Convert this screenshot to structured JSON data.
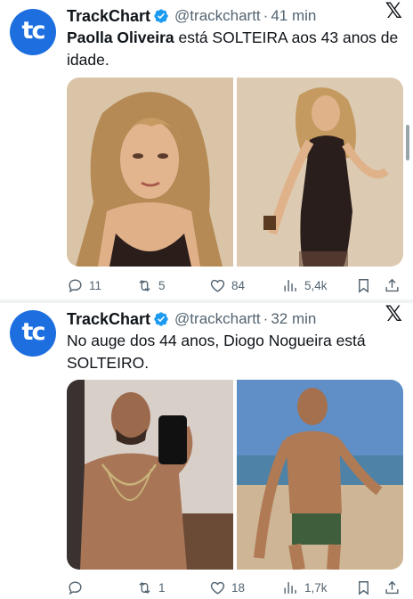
{
  "colors": {
    "accent": "#1d9bf0",
    "avatar_bg": "#1d6fe0",
    "text": "#0f1419",
    "muted": "#536471"
  },
  "tweets": [
    {
      "author": {
        "name": "TrackChart",
        "handle": "@trackchartt",
        "avatar_text": "tc",
        "verified": true
      },
      "separator": "·",
      "time": "41 min",
      "text_bold": "Paolla Oliveira",
      "text_rest": " está SOLTEIRA aos 43 anos de idade.",
      "media": [
        "photo-woman-portrait",
        "photo-woman-black-dress"
      ],
      "stats": {
        "replies": "11",
        "retweets": "5",
        "likes": "84",
        "views": "5,4k"
      }
    },
    {
      "author": {
        "name": "TrackChart",
        "handle": "@trackchartt",
        "avatar_text": "tc",
        "verified": true
      },
      "separator": "·",
      "time": "32 min",
      "text_bold": "",
      "text_rest": "No auge dos 44 anos, Diogo Nogueira está SOLTEIRO.",
      "media": [
        "photo-man-mirror-selfie",
        "photo-man-beach"
      ],
      "stats": {
        "replies": "",
        "retweets": "1",
        "likes": "18",
        "views": "1,7k"
      }
    }
  ],
  "icons": [
    "verified-badge-icon",
    "x-logo-icon",
    "reply-icon",
    "retweet-icon",
    "like-icon",
    "views-icon",
    "bookmark-icon",
    "share-icon"
  ]
}
